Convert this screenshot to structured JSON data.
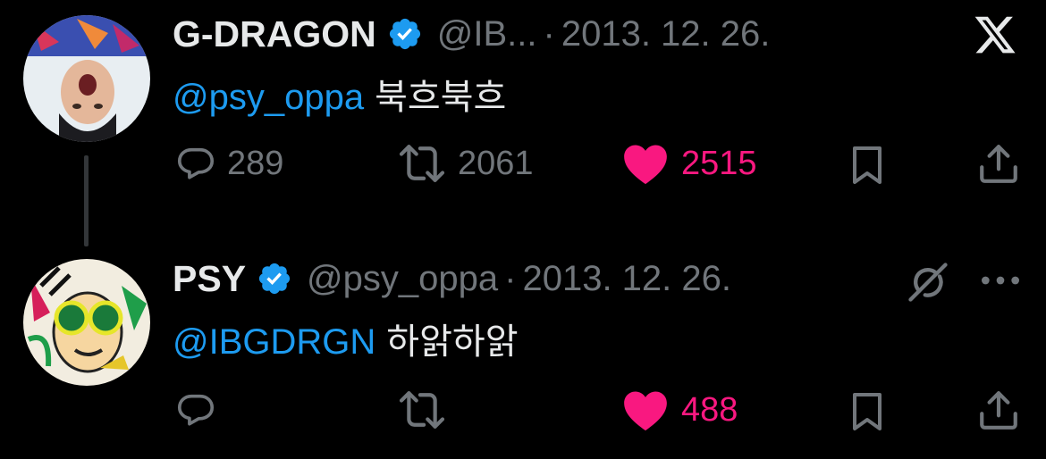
{
  "tweets": [
    {
      "display_name": "G-DRAGON",
      "handle": "@IB...",
      "separator": "·",
      "date": "2013. 12. 26.",
      "mention": "@psy_oppa",
      "text": "북흐북흐",
      "replies": "289",
      "retweets": "2061",
      "likes": "2515",
      "liked": true
    },
    {
      "display_name": "PSY",
      "handle": "@psy_oppa",
      "separator": "·",
      "date": "2013. 12. 26.",
      "mention": "@IBGDRGN",
      "text": "하앍하앍",
      "replies": "",
      "retweets": "",
      "likes": "488",
      "liked": true
    }
  ],
  "icons": {
    "app_logo": "x-logo-icon",
    "reply": "speech-bubble-icon",
    "retweet": "retweet-arrows-icon",
    "like": "heart-icon",
    "bookmark": "bookmark-icon",
    "share": "share-upload-icon",
    "grok": "grok-slash-icon",
    "more": "more-dots-icon",
    "verified": "verified-badge-icon"
  },
  "colors": {
    "background": "#000000",
    "text_primary": "#e7e9ea",
    "text_secondary": "#71767b",
    "mention": "#1d9bf0",
    "verified": "#1d9bf0",
    "like": "#f91880",
    "thread_line": "#333639"
  }
}
